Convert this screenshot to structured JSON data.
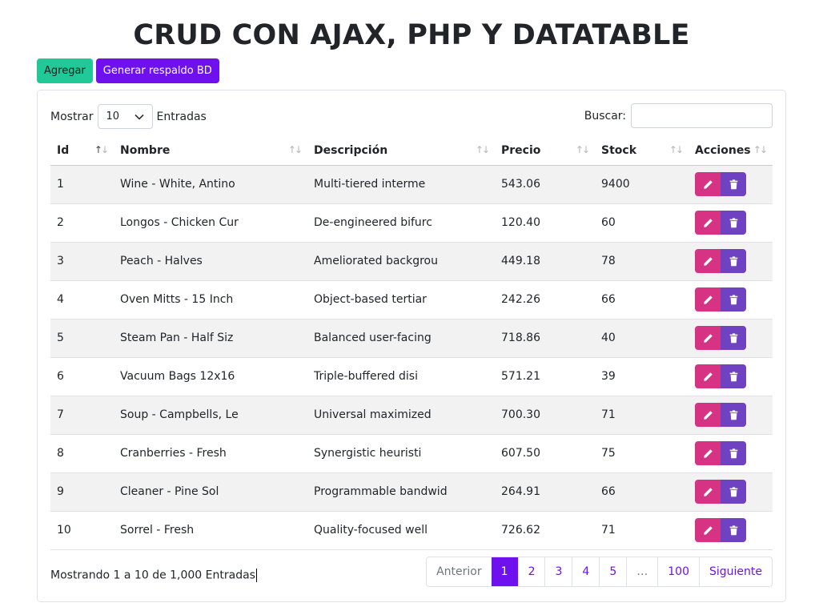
{
  "title": "CRUD CON AJAX, PHP Y DATATABLE",
  "toolbar": {
    "add_label": "Agregar",
    "backup_label": "Generar respaldo BD"
  },
  "length": {
    "label_before": "Mostrar",
    "value": "10",
    "label_after": "Entradas"
  },
  "search": {
    "label": "Buscar:",
    "value": ""
  },
  "table": {
    "headers": [
      "Id",
      "Nombre",
      "Descripción",
      "Precio",
      "Stock",
      "Acciones"
    ],
    "rows": [
      [
        "1",
        "Wine - White, Antino",
        "Multi-tiered interme",
        "543.06",
        "9400"
      ],
      [
        "2",
        "Longos - Chicken Cur",
        "De-engineered bifurc",
        "120.40",
        "60"
      ],
      [
        "3",
        "Peach - Halves",
        "Ameliorated backgrou",
        "449.18",
        "78"
      ],
      [
        "4",
        "Oven Mitts - 15 Inch",
        "Object-based tertiar",
        "242.26",
        "66"
      ],
      [
        "5",
        "Steam Pan - Half Siz",
        "Balanced user-facing",
        "718.86",
        "40"
      ],
      [
        "6",
        "Vacuum Bags 12x16",
        "Triple-buffered disi",
        "571.21",
        "39"
      ],
      [
        "7",
        "Soup - Campbells, Le",
        "Universal maximized",
        "700.30",
        "71"
      ],
      [
        "8",
        "Cranberries - Fresh",
        "Synergistic heuristi",
        "607.50",
        "75"
      ],
      [
        "9",
        "Cleaner - Pine Sol",
        "Programmable bandwid",
        "264.91",
        "66"
      ],
      [
        "10",
        "Sorrel - Fresh",
        "Quality-focused well",
        "726.62",
        "71"
      ]
    ]
  },
  "info": "Mostrando 1 a 10 de 1,000 Entradas",
  "pagination": {
    "prev": "Anterior",
    "pages": [
      "1",
      "2",
      "3",
      "4",
      "5",
      "…",
      "100"
    ],
    "active": "1",
    "next": "Siguiente"
  },
  "icons": {
    "edit": "pencil-icon",
    "delete": "trash-icon"
  },
  "colors": {
    "add": "#20c997",
    "backup": "#6f10ef",
    "edit": "#d63384",
    "delete": "#6f42c1"
  }
}
